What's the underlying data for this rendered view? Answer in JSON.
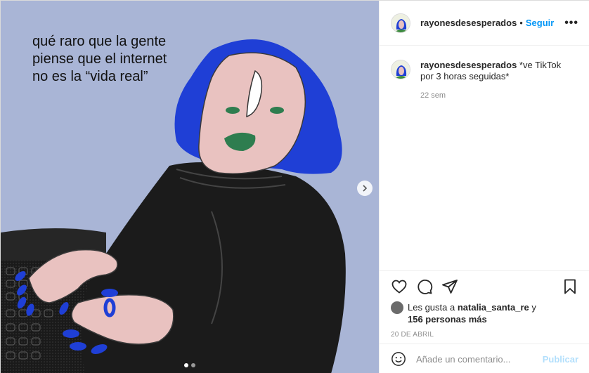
{
  "post": {
    "image_text": "qué raro que la gente\npiense que el internet\nno es la “vida real”",
    "carousel": {
      "count": 2,
      "active_index": 0
    }
  },
  "header": {
    "username": "rayonesdesesperados",
    "separator": "•",
    "follow_label": "Seguir",
    "more_label": "•••"
  },
  "caption": {
    "username": "rayonesdesesperados",
    "text": "*ve TikTok por 3 horas seguidas*",
    "time": "22 sem"
  },
  "likes": {
    "prefix": "Les gusta a",
    "user": "natalia_santa_re",
    "middle": "y",
    "others": "156 personas más"
  },
  "date": "20 DE ABRIL",
  "comment_box": {
    "placeholder": "Añade un comentario...",
    "publish_label": "Publicar"
  },
  "icons": {
    "like": "heart-icon",
    "comment": "comment-icon",
    "share": "share-icon",
    "save": "bookmark-icon",
    "emoji": "emoji-icon",
    "next": "chevron-right-icon"
  },
  "colors": {
    "accent": "#0095f6",
    "publish_disabled": "#b2dffc",
    "image_bg": "#a9b5d6",
    "hair": "#1f3fd6",
    "lips": "#2e7d4f"
  }
}
